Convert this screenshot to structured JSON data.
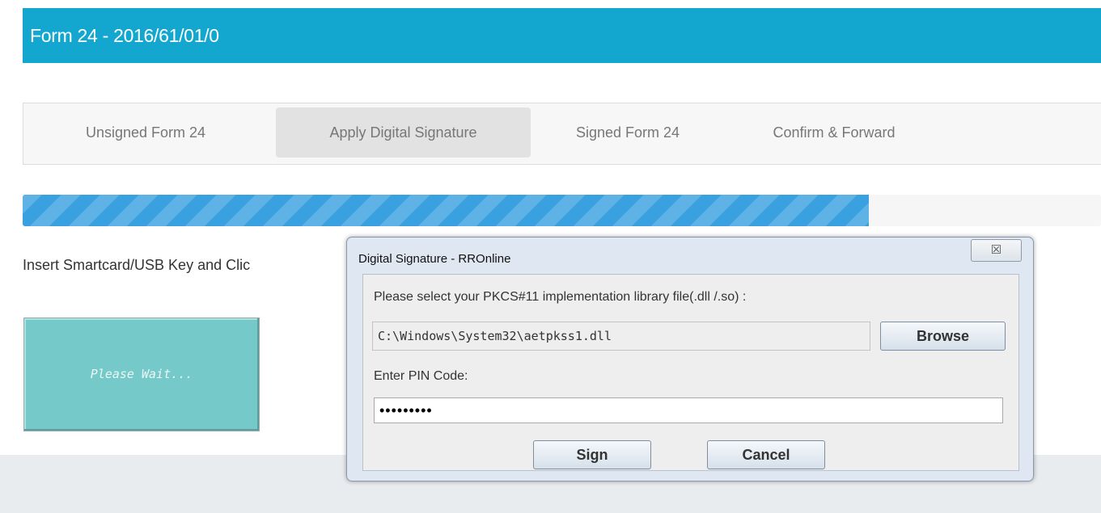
{
  "header": {
    "title": "Form 24 - 2016/61/01/0"
  },
  "tabs": [
    {
      "label": "Unsigned Form 24",
      "active": false
    },
    {
      "label": "Apply Digital Signature",
      "active": true
    },
    {
      "label": "Signed Form 24",
      "active": false
    },
    {
      "label": "Confirm & Forward",
      "active": false
    }
  ],
  "progress": {
    "value_fraction": 0.785
  },
  "instruction": {
    "text": "Insert Smartcard/USB Key and Clic"
  },
  "wait_button": {
    "label": "Please Wait..."
  },
  "dialog": {
    "title": "Digital Signature - RROnline",
    "close_glyph": "☒",
    "library_prompt": "Please select your PKCS#11 implementation library file(.dll /.so) :",
    "library_path": "C:\\Windows\\System32\\aetpkss1.dll",
    "browse_label": "Browse",
    "pin_label": "Enter PIN Code:",
    "pin_value": "•••••••••",
    "sign_label": "Sign",
    "cancel_label": "Cancel"
  },
  "colors": {
    "header_bg": "#13a7cf",
    "progress_fill": "#3aa1e0",
    "wait_button_bg": "#75c9c8",
    "dialog_bg": "#dfe8f2"
  }
}
